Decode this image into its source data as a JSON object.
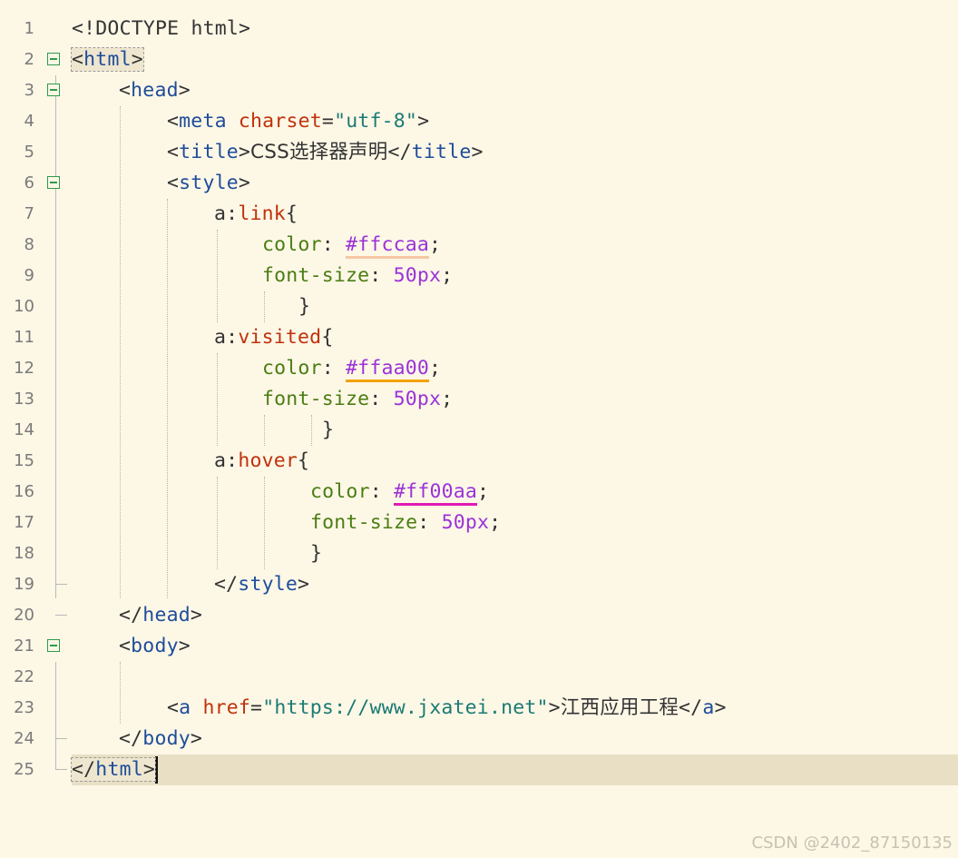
{
  "editor": {
    "lines": [
      {
        "num": "1"
      },
      {
        "num": "2"
      },
      {
        "num": "3"
      },
      {
        "num": "4"
      },
      {
        "num": "5"
      },
      {
        "num": "6"
      },
      {
        "num": "7"
      },
      {
        "num": "8"
      },
      {
        "num": "9"
      },
      {
        "num": "10"
      },
      {
        "num": "11"
      },
      {
        "num": "12"
      },
      {
        "num": "13"
      },
      {
        "num": "14"
      },
      {
        "num": "15"
      },
      {
        "num": "16"
      },
      {
        "num": "17"
      },
      {
        "num": "18"
      },
      {
        "num": "19"
      },
      {
        "num": "20"
      },
      {
        "num": "21"
      },
      {
        "num": "22"
      },
      {
        "num": "23"
      },
      {
        "num": "24"
      },
      {
        "num": "25"
      }
    ],
    "code": {
      "l1": {
        "doctype": "<!DOCTYPE html>"
      },
      "l2": {
        "open": "<",
        "tag": "html",
        "close": ">"
      },
      "l3": {
        "open": "<",
        "tag": "head",
        "close": ">"
      },
      "l4": {
        "open": "<",
        "tag": "meta",
        "attr": "charset",
        "eq": "=",
        "val": "\"utf-8\"",
        "close": ">"
      },
      "l5": {
        "open": "<",
        "tag": "title",
        "close": ">",
        "text": "CSS选择器声明",
        "open2": "</",
        "tag2": "title",
        "close2": ">"
      },
      "l6": {
        "open": "<",
        "tag": "style",
        "close": ">"
      },
      "l7": {
        "a": "a",
        "colon": ":",
        "pseudo": "link",
        "brace": "{"
      },
      "l8": {
        "prop": "color",
        "colon": ": ",
        "val": "#ffccaa",
        "semi": ";"
      },
      "l9": {
        "prop": "font-size",
        "colon": ": ",
        "val": "50px",
        "semi": ";"
      },
      "l10": {
        "brace": "}"
      },
      "l11": {
        "a": "a",
        "colon": ":",
        "pseudo": "visited",
        "brace": "{"
      },
      "l12": {
        "prop": "color",
        "colon": ": ",
        "val": "#ffaa00",
        "semi": ";"
      },
      "l13": {
        "prop": "font-size",
        "colon": ": ",
        "val": "50px",
        "semi": ";"
      },
      "l14": {
        "brace": "}"
      },
      "l15": {
        "a": "a",
        "colon": ":",
        "pseudo": "hover",
        "brace": "{"
      },
      "l16": {
        "prop": "color",
        "colon": ": ",
        "val": "#ff00aa",
        "semi": ";"
      },
      "l17": {
        "prop": "font-size",
        "colon": ": ",
        "val": "50px",
        "semi": ";"
      },
      "l18": {
        "brace": "}"
      },
      "l19": {
        "open": "</",
        "tag": "style",
        "close": ">"
      },
      "l20": {
        "open": "</",
        "tag": "head",
        "close": ">"
      },
      "l21": {
        "open": "<",
        "tag": "body",
        "close": ">"
      },
      "l22": {},
      "l23": {
        "open": "<",
        "tag": "a",
        "space": " ",
        "attr": "href",
        "eq": "=",
        "val": "\"https://www.jxatei.net\"",
        "close": ">",
        "text": "江西应用工程",
        "open2": "</",
        "tag2": "a",
        "close2": ">"
      },
      "l24": {
        "open": "</",
        "tag": "body",
        "close": ">"
      },
      "l25": {
        "open": "</",
        "tag": "html",
        "close": ">"
      }
    }
  },
  "colors": {
    "background": "#fdf7e6",
    "current_line": "#e8dfc4",
    "tag": "#1e4d9a",
    "attribute": "#c0320b",
    "string": "#1b7a74",
    "property": "#4a7d12",
    "value": "#9a33d8",
    "swatch_link": "#ffccaa",
    "swatch_visited": "#ffaa00",
    "swatch_hover": "#ff00aa"
  },
  "watermark": "CSDN @2402_87150135"
}
